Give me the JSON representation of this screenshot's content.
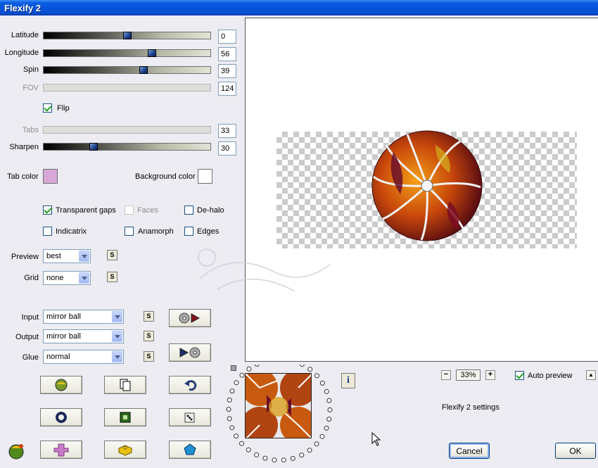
{
  "window": {
    "title": "Flexify 2"
  },
  "sliders": [
    {
      "label": "Latitude",
      "value": "0",
      "fraction": 0.5,
      "enabled": true
    },
    {
      "label": "Longitude",
      "value": "56",
      "fraction": 0.65,
      "enabled": true
    },
    {
      "label": "Spin",
      "value": "39",
      "fraction": 0.6,
      "enabled": true
    },
    {
      "label": "FOV",
      "value": "124",
      "fraction": null,
      "enabled": false
    },
    {
      "label": "Tabs",
      "value": "33",
      "fraction": null,
      "enabled": false
    },
    {
      "label": "Sharpen",
      "value": "30",
      "fraction": 0.3,
      "enabled": true
    }
  ],
  "flip": {
    "label": "Flip",
    "checked": true
  },
  "tab_color": {
    "label": "Tab color",
    "color": "#d8a8d8"
  },
  "background_color": {
    "label": "Background color",
    "color": "#ffffff"
  },
  "options": {
    "transparent_gaps": {
      "label": "Transparent gaps",
      "checked": true
    },
    "faces": {
      "label": "Faces",
      "checked": false,
      "enabled": false
    },
    "dehalo": {
      "label": "De-halo",
      "checked": false
    },
    "indicatrix": {
      "label": "Indicatrix",
      "checked": false
    },
    "anamorph": {
      "label": "Anamorph",
      "checked": false
    },
    "edges": {
      "label": "Edges",
      "checked": false
    }
  },
  "preview_select": {
    "label": "Preview",
    "value": "best"
  },
  "grid_select": {
    "label": "Grid",
    "value": "none"
  },
  "input_select": {
    "label": "Input",
    "value": "mirror ball"
  },
  "output_select": {
    "label": "Output",
    "value": "mirror ball"
  },
  "glue_select": {
    "label": "Glue",
    "value": "normal"
  },
  "s_button_label": "S",
  "zoom": {
    "value": "33%",
    "minus": "−",
    "plus": "+"
  },
  "auto_preview": {
    "label": "Auto preview",
    "checked": true
  },
  "scroll_up_icon": "▲",
  "settings_title": "Flexify 2 settings",
  "buttons": {
    "cancel": "Cancel",
    "ok": "OK"
  },
  "info_icon": "i",
  "colors": {
    "title_bar": "#0553d9",
    "panel": "#ececf2",
    "accent_check": "#21a121"
  }
}
